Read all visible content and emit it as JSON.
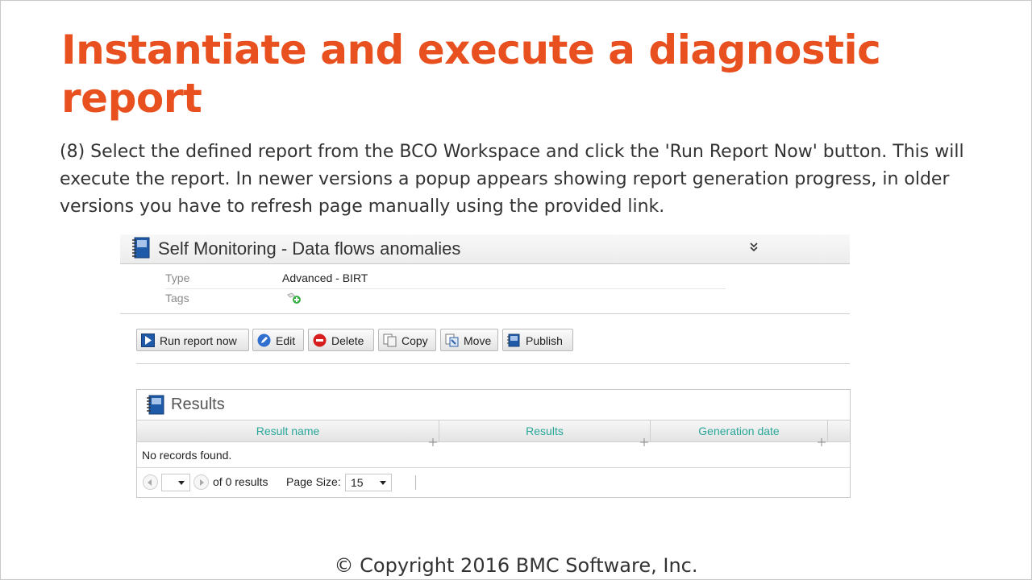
{
  "slide": {
    "title": "Instantiate and execute a diagnostic report",
    "body": "(8) Select the defined report from the BCO Workspace and click the 'Run Report Now' button. This will execute the report. In newer versions a popup appears showing report generation progress, in older versions you have to refresh page manually using the provided link.",
    "copyright": "© Copyright 2016 BMC Software, Inc."
  },
  "report": {
    "title": "Self Monitoring - Data flows anomalies",
    "collapse_glyph": "»",
    "props": [
      {
        "label": "Type",
        "value": "Advanced - BIRT"
      },
      {
        "label": "Tags",
        "value": ""
      }
    ]
  },
  "toolbar": {
    "run_label": "Run report now",
    "edit_label": "Edit",
    "delete_label": "Delete",
    "copy_label": "Copy",
    "move_label": "Move",
    "publish_label": "Publish"
  },
  "results": {
    "title": "Results",
    "columns": [
      "Result name",
      "Results",
      "Generation date"
    ],
    "empty_message": "No records found.",
    "pager": {
      "page_value": "",
      "of_text": "of 0 results",
      "page_size_label": "Page Size:",
      "page_size_value": "15"
    }
  },
  "colors": {
    "title": "#e8511f",
    "column_header_text": "#2aa79a"
  }
}
